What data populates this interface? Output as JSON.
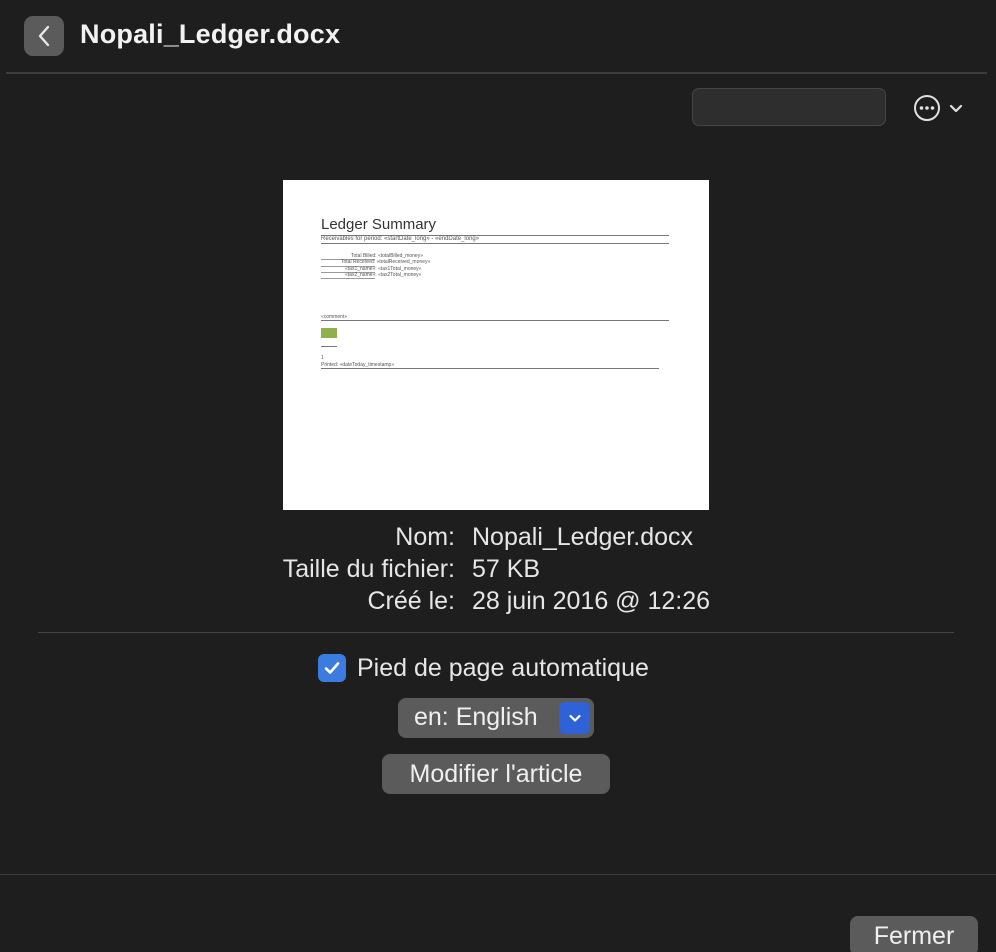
{
  "header": {
    "title": "Nopali_Ledger.docx"
  },
  "preview": {
    "heading": "Ledger Summary",
    "subtitle": "Receivables for period: «startDate_long» - «endDate_long»",
    "lines": [
      "Total Billed: «totalBilled_money»",
      "Total Received: «totalReceived_money»",
      "«tax1_name»: «tax1Total_money»",
      "«tax2_name»: «tax2Total_money»"
    ],
    "comment": "«comment»",
    "page_number": "1",
    "printed": "Printed: «dateToday_timestamp»"
  },
  "info": {
    "name_label": "Nom:",
    "name_value": "Nopali_Ledger.docx",
    "size_label": "Taille du fichier:",
    "size_value": "57 KB",
    "created_label": "Créé le:",
    "created_value": "28 juin 2016 @ 12:26"
  },
  "options": {
    "auto_footer_label": "Pied de page automatique",
    "auto_footer_checked": true,
    "language_value": "en: English"
  },
  "buttons": {
    "edit_label": "Modifier l'article",
    "close_label": "Fermer"
  },
  "colors": {
    "background": "#1e1e1e",
    "button": "#5b5b5b",
    "accent": "#3c7be0"
  },
  "icons": {
    "back": "chevron-left-icon",
    "more": "ellipsis-circle-icon",
    "dropdown": "chevron-down-icon",
    "check": "checkmark-icon"
  }
}
